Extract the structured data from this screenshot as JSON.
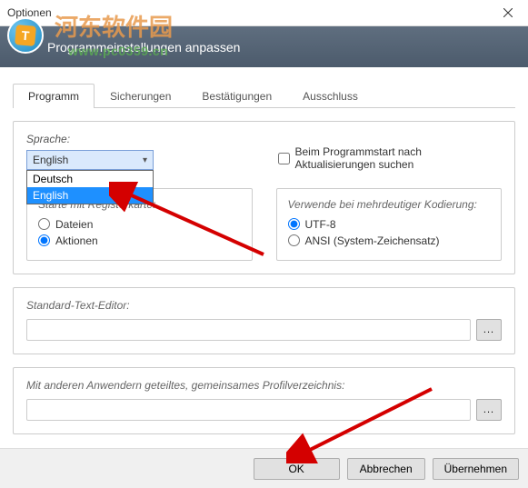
{
  "window": {
    "title": "Optionen"
  },
  "banner": {
    "subtitle": "Programmeinstellungen anpassen"
  },
  "watermark": {
    "main": "河东软件园",
    "sub": "www.pc0359.cn"
  },
  "tabs": {
    "items": [
      {
        "label": "Programm"
      },
      {
        "label": "Sicherungen"
      },
      {
        "label": "Bestätigungen"
      },
      {
        "label": "Ausschluss"
      }
    ]
  },
  "lang": {
    "label": "Sprache:",
    "selected": "English",
    "options": [
      {
        "label": "Deutsch"
      },
      {
        "label": "English"
      }
    ]
  },
  "update_check": {
    "label": "Beim Programmstart nach Aktualisierungen suchen"
  },
  "start_tab": {
    "title": "Starte mit Registerkarte:",
    "opt_files": "Dateien",
    "opt_actions": "Aktionen"
  },
  "encoding": {
    "title": "Verwende bei mehrdeutiger Kodierung:",
    "opt_utf8": "UTF-8",
    "opt_ansi": "ANSI (System-Zeichensatz)"
  },
  "editor": {
    "title": "Standard-Text-Editor:",
    "value": "",
    "browse": "..."
  },
  "profile": {
    "title": "Mit anderen Anwendern geteiltes, gemeinsames Profilverzeichnis:",
    "value": "",
    "browse": "..."
  },
  "buttons": {
    "ok": "OK",
    "cancel": "Abbrechen",
    "apply": "Übernehmen"
  }
}
